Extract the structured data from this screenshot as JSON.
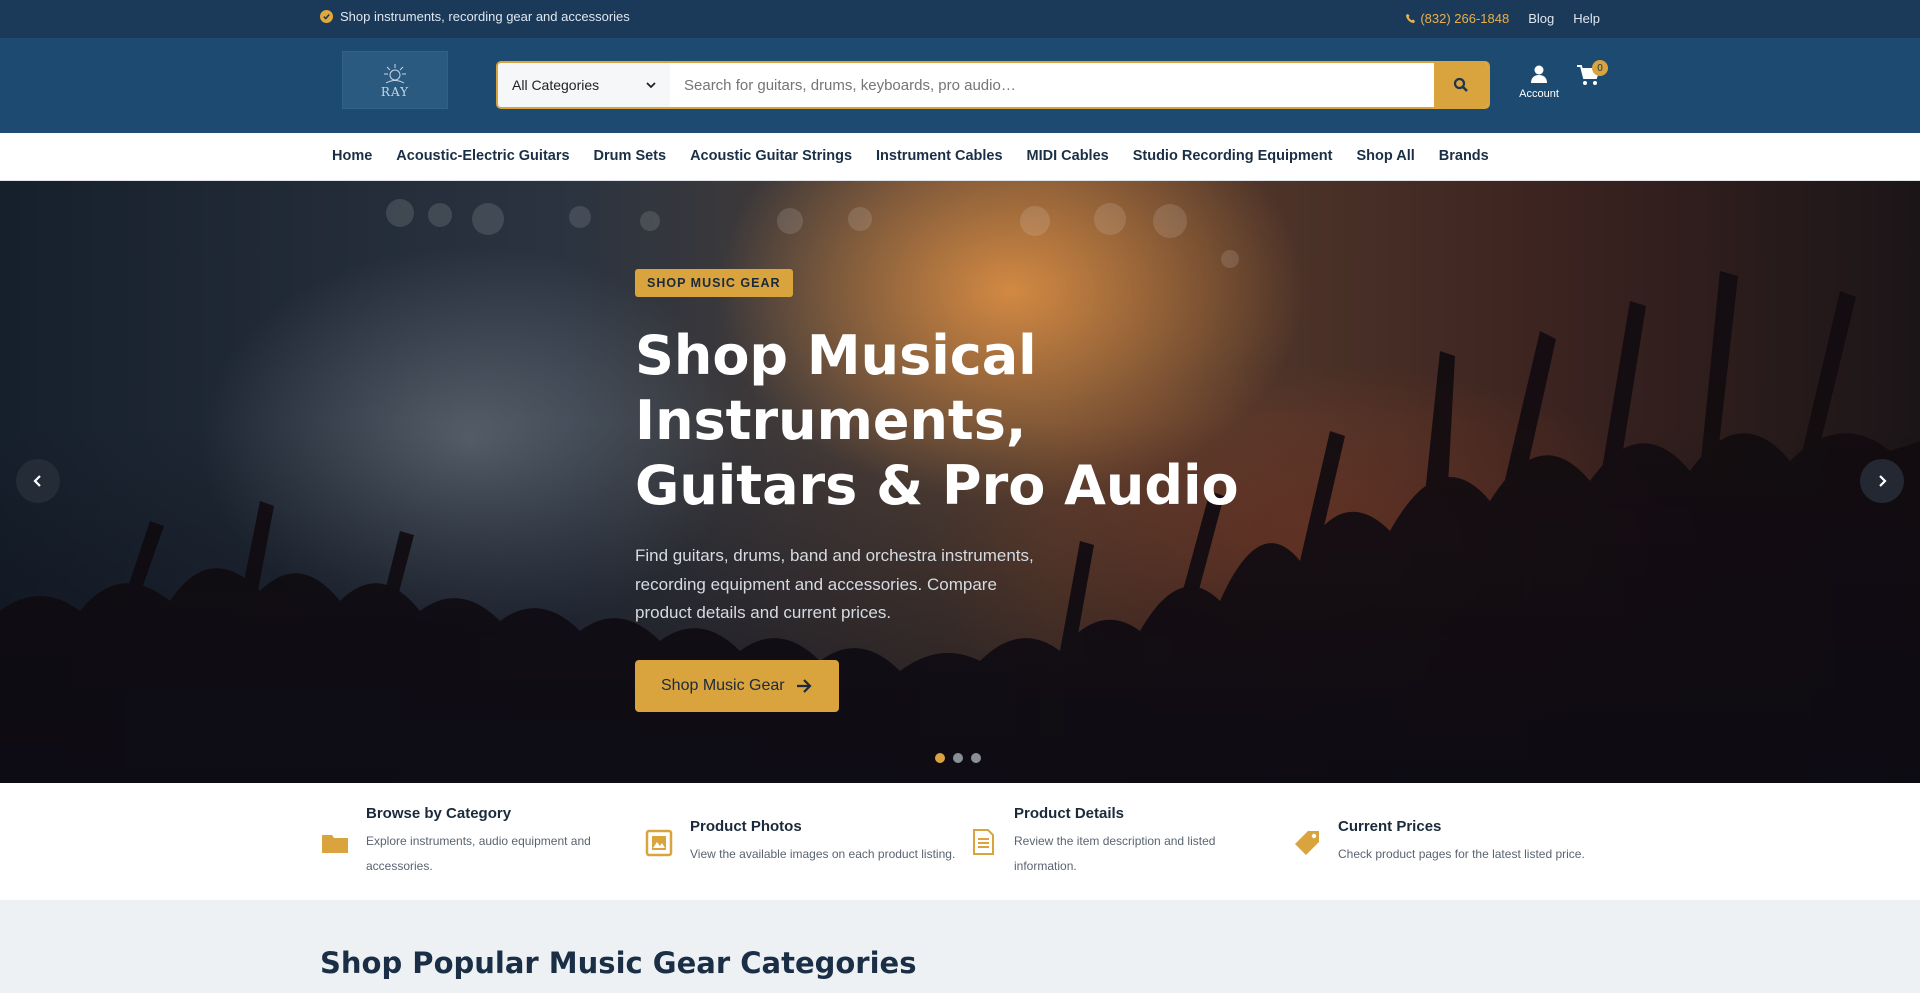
{
  "topbar": {
    "tagline": "Shop instruments, recording gear and accessories",
    "phone": "(832) 266-1848",
    "links": [
      "Blog",
      "Help"
    ]
  },
  "header": {
    "logo_text": "RAY",
    "category_select": "All Categories",
    "search_placeholder": "Search for guitars, drums, keyboards, pro audio…",
    "account_label": "Account",
    "cart_count": "0"
  },
  "nav": {
    "items": [
      "Home",
      "Acoustic-Electric Guitars",
      "Drum Sets",
      "Acoustic Guitar Strings",
      "Instrument Cables",
      "MIDI Cables",
      "Studio Recording Equipment",
      "Shop All",
      "Brands"
    ]
  },
  "hero": {
    "badge": "SHOP MUSIC GEAR",
    "title": "Shop Musical Instruments, Guitars & Pro Audio",
    "description": "Find guitars, drums, band and orchestra instruments, recording equipment and accessories. Compare product details and current prices.",
    "cta_label": "Shop Music Gear",
    "slide_count": 3,
    "active_slide": 1
  },
  "features": [
    {
      "icon": "folder-icon",
      "title": "Browse by Category",
      "desc": "Explore instruments, audio equipment and accessories."
    },
    {
      "icon": "image-icon",
      "title": "Product Photos",
      "desc": "View the available images on each product listing."
    },
    {
      "icon": "document-icon",
      "title": "Product Details",
      "desc": "Review the item description and listed information."
    },
    {
      "icon": "tag-icon",
      "title": "Current Prices",
      "desc": "Check product pages for the latest listed price."
    }
  ],
  "popular": {
    "heading": "Shop Popular Music Gear Categories"
  },
  "colors": {
    "topbar": "#1b3a5a",
    "header": "#1d4a70",
    "accent": "#d9a33e",
    "text_dark": "#1a2f45"
  }
}
